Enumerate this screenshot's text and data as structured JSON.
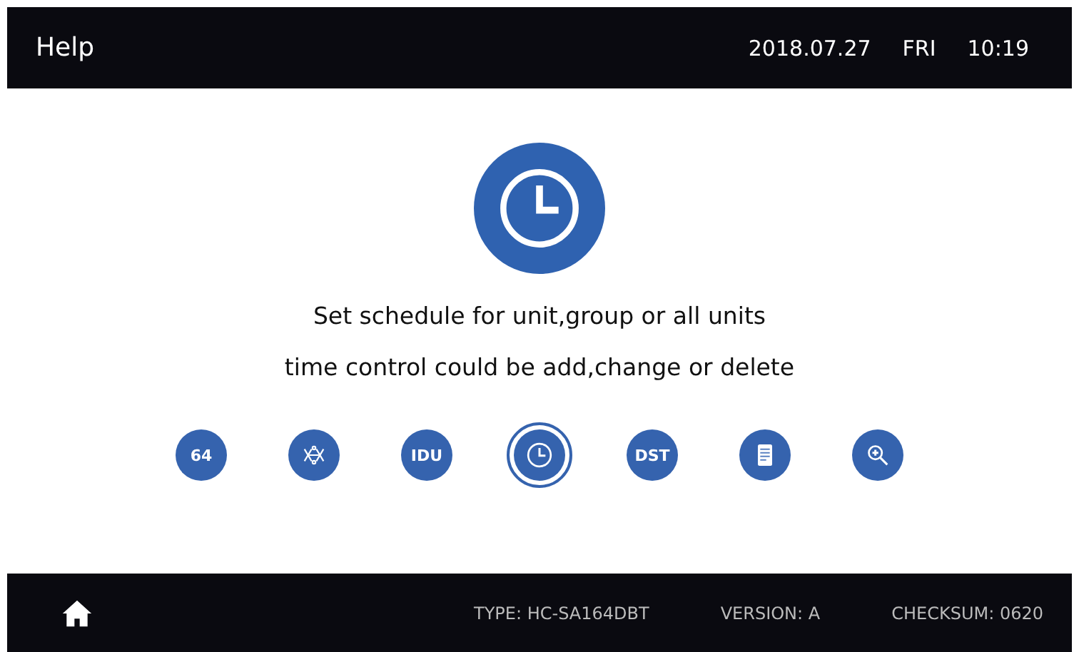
{
  "header": {
    "title": "Help",
    "date": "2018.07.27",
    "weekday": "FRI",
    "time": "10:19"
  },
  "main_icon": {
    "kind": "clock"
  },
  "description": [
    "Set schedule for unit,group or all units",
    "time control could be add,change or delete"
  ],
  "help_topics": [
    {
      "kind": "text",
      "label": "64",
      "selected": false
    },
    {
      "kind": "network",
      "selected": false
    },
    {
      "kind": "text",
      "label": "IDU",
      "selected": false
    },
    {
      "kind": "clock",
      "selected": true
    },
    {
      "kind": "text",
      "label": "DST",
      "selected": false
    },
    {
      "kind": "document",
      "selected": false
    },
    {
      "kind": "zoom",
      "selected": false
    }
  ],
  "footer": {
    "type": "TYPE: HC-SA164DBT",
    "version": "VERSION: A",
    "checksum": "CHECKSUM: 0620"
  }
}
